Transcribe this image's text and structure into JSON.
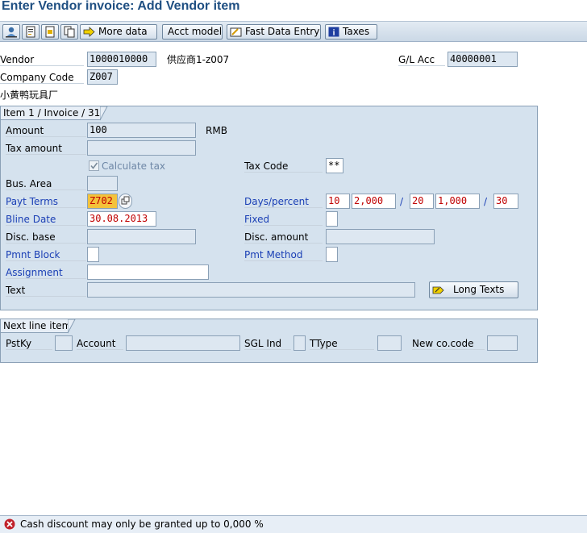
{
  "window_title": "Enter Vendor invoice: Add Vendor item",
  "toolbar": {
    "more_data": "More data",
    "acct_model": "Acct model",
    "fast_data_entry": "Fast Data Entry",
    "taxes": "Taxes"
  },
  "header": {
    "vendor_label": "Vendor",
    "vendor_value": "1000010000",
    "vendor_name": "供应商1-z007",
    "gl_acc_label": "G/L Acc",
    "gl_acc_value": "40000001",
    "company_code_label": "Company Code",
    "company_code_value": "Z007",
    "company_name": "小黄鸭玩具厂"
  },
  "item": {
    "tab_label": "Item 1 / Invoice / 31",
    "amount_label": "Amount",
    "amount_value": "100",
    "currency": "RMB",
    "tax_amount_label": "Tax amount",
    "tax_amount_value": "",
    "calc_tax_label": "Calculate tax",
    "calc_tax_checked": true,
    "tax_code_label": "Tax Code",
    "tax_code_value": "**",
    "bus_area_label": "Bus. Area",
    "bus_area_value": "",
    "payt_terms_label": "Payt Terms",
    "payt_terms_value": "Z702",
    "days_percent_label": "Days/percent",
    "days1": "10",
    "pct1": "2,000",
    "days2": "20",
    "pct2": "1,000",
    "days3": "30",
    "sep": "/",
    "bline_date_label": "Bline Date",
    "bline_date_value": "30.08.2013",
    "fixed_label": "Fixed",
    "disc_base_label": "Disc. base",
    "disc_amount_label": "Disc. amount",
    "pmnt_block_label": "Pmnt Block",
    "pmt_method_label": "Pmt Method",
    "assignment_label": "Assignment",
    "text_label": "Text",
    "long_texts_label": "Long Texts"
  },
  "next_line": {
    "tab_label": "Next line item",
    "pstky_label": "PstKy",
    "account_label": "Account",
    "sgl_ind_label": "SGL Ind",
    "ttype_label": "TType",
    "new_cocode_label": "New co.code"
  },
  "status": {
    "message": "Cash discount may only be granted up to 0,000 %",
    "type": "error",
    "color": "#c0202a"
  },
  "colors": {
    "title": "#1f4f82",
    "required_label": "#1a3fb5",
    "group_bg": "#d5e2ee",
    "highlight": "#f4c23a"
  }
}
